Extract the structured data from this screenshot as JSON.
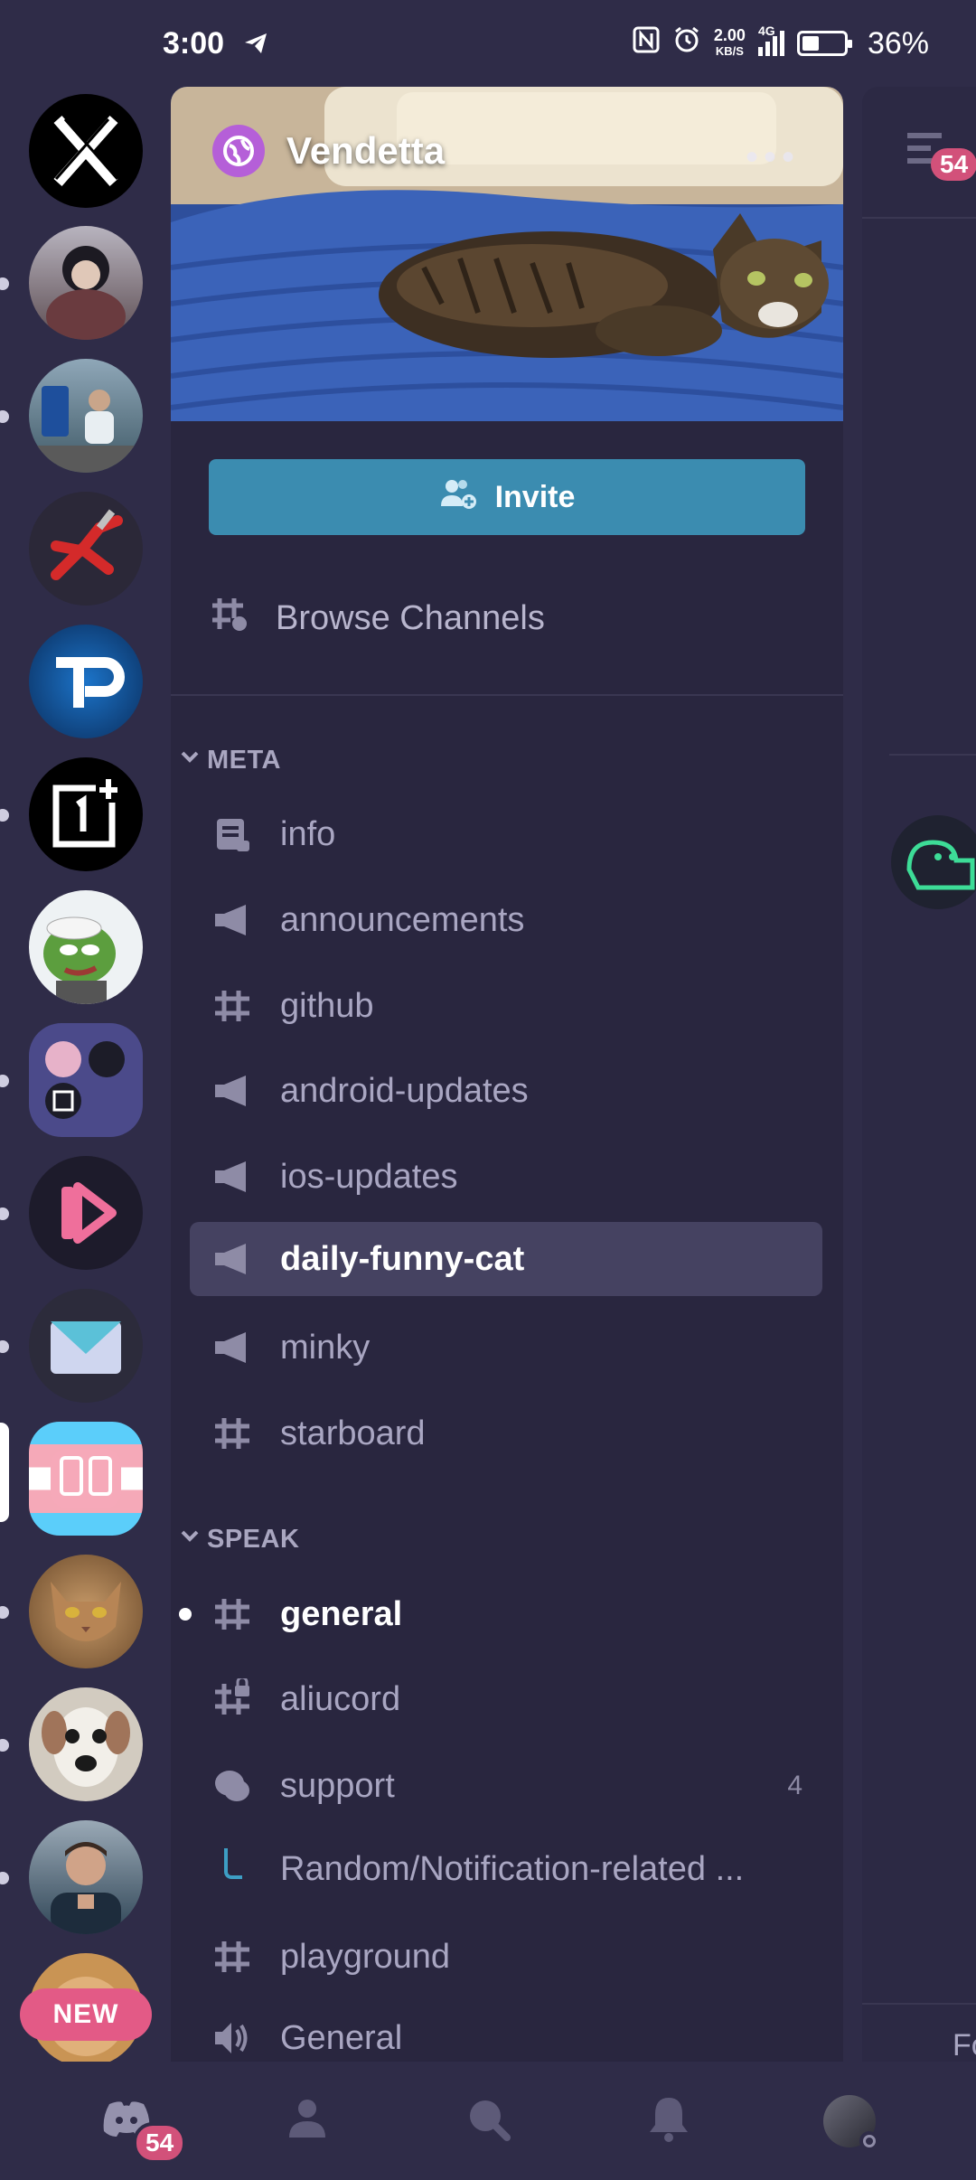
{
  "status_bar": {
    "time": "3:00",
    "net_speed": "2.00",
    "net_unit": "KB/S",
    "network": "4G",
    "battery": "36%"
  },
  "server_rail": {
    "servers": [
      {
        "name": "x-server",
        "color": "#000000"
      },
      {
        "name": "anime-avatar",
        "color": "#7a6d76"
      },
      {
        "name": "photo-person",
        "color": "#4a6e86"
      },
      {
        "name": "pliers",
        "color": "#2a2838"
      },
      {
        "name": "tp-logo",
        "color": "#0d4a8a"
      },
      {
        "name": "oneplus",
        "color": "#000000"
      },
      {
        "name": "pepe",
        "color": "#e9eef0"
      },
      {
        "name": "folder",
        "color": "#4a4a8a"
      },
      {
        "name": "pink-play",
        "color": "#1b1b2a"
      },
      {
        "name": "mail",
        "color": "#2b2b3b"
      },
      {
        "name": "trans-discord",
        "color": "#f5a9b8"
      },
      {
        "name": "cat-face",
        "color": "#b28559"
      },
      {
        "name": "dog-face",
        "color": "#c9c1b5"
      },
      {
        "name": "man-photo",
        "color": "#2c4253"
      },
      {
        "name": "face-bottom",
        "color": "#c98f4a"
      }
    ],
    "new_badge": "NEW"
  },
  "server": {
    "name": "Vendetta",
    "more": "•••"
  },
  "invite_label": "Invite",
  "browse_label": "Browse Channels",
  "categories": {
    "meta": "META",
    "speak": "SPEAK"
  },
  "channels_meta": [
    {
      "name": "info",
      "icon": "rules-icon"
    },
    {
      "name": "announcements",
      "icon": "megaphone-icon"
    },
    {
      "name": "github",
      "icon": "hash-icon"
    },
    {
      "name": "android-updates",
      "icon": "megaphone-icon"
    },
    {
      "name": "ios-updates",
      "icon": "megaphone-icon"
    },
    {
      "name": "daily-funny-cat",
      "icon": "megaphone-icon",
      "active": true
    },
    {
      "name": "minky",
      "icon": "megaphone-icon"
    },
    {
      "name": "starboard",
      "icon": "hash-icon"
    }
  ],
  "channels_speak": [
    {
      "name": "general",
      "icon": "hash-icon",
      "unread": true
    },
    {
      "name": "aliucord",
      "icon": "hash-lock-icon"
    },
    {
      "name": "support",
      "icon": "forum-icon",
      "count": "4"
    },
    {
      "name": "Random/Notification-related ...",
      "icon": "thread-icon"
    },
    {
      "name": "playground",
      "icon": "hash-icon"
    },
    {
      "name": "General",
      "icon": "speaker-icon"
    }
  ],
  "right_panel": {
    "badge": "54",
    "footer_text": "Fo"
  },
  "bottom_nav": {
    "home_badge": "54"
  },
  "colors": {
    "background": "#2f2c48",
    "panel": "#29263f",
    "active_channel": "#454261",
    "invite": "#3b8cb0",
    "badge": "#d2517a"
  }
}
